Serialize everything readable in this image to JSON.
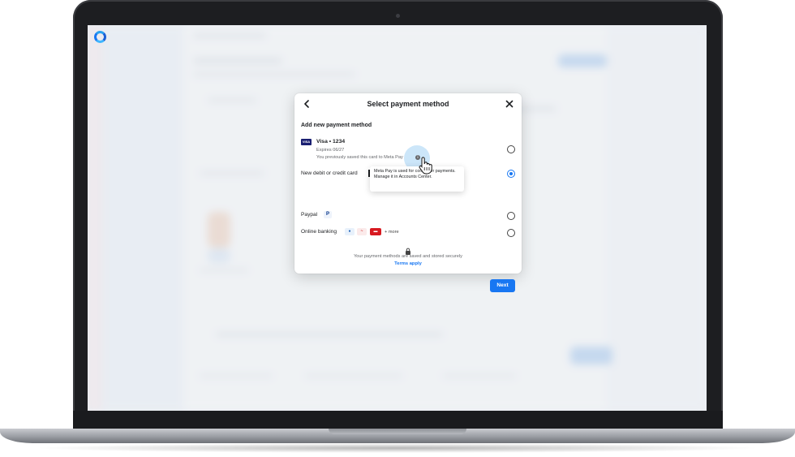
{
  "dialog": {
    "title": "Select payment method",
    "section_title": "Add new payment method",
    "saved_card": {
      "brand": "VISA",
      "name": "Visa • 1234",
      "expires": "Expires 06/27",
      "note": "You previously saved this card to Meta Pay",
      "selected": false
    },
    "tooltip": "Meta Pay is used for consumer payments. Manage it in Accounts Center.",
    "options": [
      {
        "label": "New debit or credit card",
        "selected": true
      },
      {
        "label": "Paypal",
        "selected": false
      },
      {
        "label": "Online banking",
        "selected": false
      }
    ],
    "banking_more": "+ more",
    "secure_text": "Your payment methods are saved and stored securely",
    "terms_link": "Terms apply",
    "next_button": "Next"
  },
  "icons": {
    "back": "back-arrow-icon",
    "close": "close-icon",
    "info": "info-icon",
    "lock": "lock-icon",
    "cursor": "pointer-hand-icon",
    "paypal": "paypal-icon"
  },
  "colors": {
    "accent": "#1877f2",
    "visa": "#1a1f71",
    "text": "#1c1e21",
    "muted": "#65676b"
  }
}
